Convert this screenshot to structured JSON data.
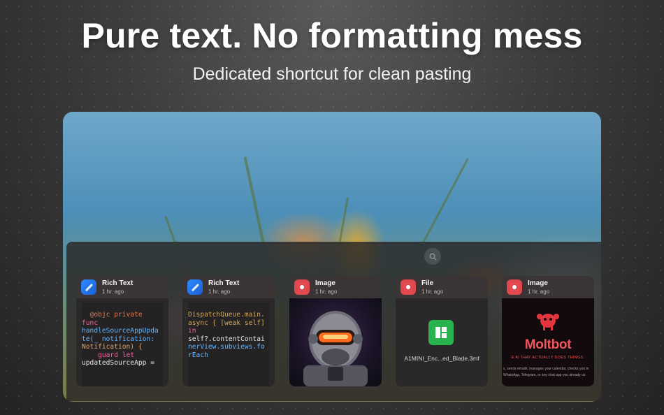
{
  "headline": "Pure text. No formatting mess",
  "subheadline": "Dedicated shortcut for clean pasting",
  "search": {
    "icon": "search-icon"
  },
  "cards": [
    {
      "type": "Rich Text",
      "time": "1 hr. ago",
      "app_icon": "xcode-icon",
      "code_lines": [
        "@objc private",
        "func",
        "handleSourceAppUpda",
        "te(_ notification:",
        "Notification) {",
        "guard let",
        "updatedSourceApp ="
      ]
    },
    {
      "type": "Rich Text",
      "time": "1 hr. ago",
      "app_icon": "xcode-icon",
      "code_lines": [
        "DispatchQueue.main.",
        "async { [weak self]",
        "in",
        "self?.contentContai",
        "nerView.subviews.fo",
        "rEach"
      ]
    },
    {
      "type": "Image",
      "time": "1 hr. ago",
      "app_icon": "clipboard-app-icon",
      "image": "astronaut-helmet-image"
    },
    {
      "type": "File",
      "time": "1 hr. ago",
      "app_icon": "clipboard-app-icon",
      "file_name": "A1MINI_Enc...ed_Blade.3mf",
      "file_icon": "bambu-studio-file-icon"
    },
    {
      "type": "Image",
      "time": "1 hr. ago",
      "app_icon": "clipboard-app-icon",
      "moltbot_title": "Moltbot",
      "moltbot_tagline": "E AI THAT ACTUALLY DOES THINGS.",
      "moltbot_desc1": "x, sends emails, manages your calendar, checks you in",
      "moltbot_desc2": "WhatsApp, Telegram, or any chat app you already us"
    }
  ],
  "colors": {
    "accent_red": "#e0484e",
    "xcode_blue": "#2d8bff",
    "file_green": "#29b34f"
  }
}
